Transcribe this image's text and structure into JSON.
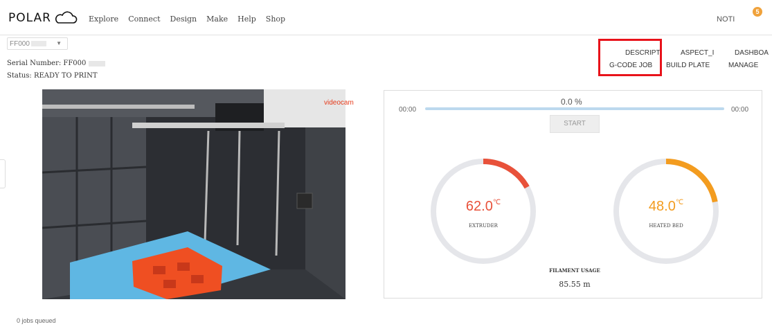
{
  "header": {
    "logo_text": "POLAR",
    "nav": [
      "Explore",
      "Connect",
      "Design",
      "Make",
      "Help",
      "Shop"
    ],
    "notifications_label": "NOTI",
    "notifications_count": "5"
  },
  "printer": {
    "selected": "FF000",
    "serial_label": "Serial Number: FF000",
    "status_label": "Status: READY TO PRINT"
  },
  "tabs": {
    "row1": [
      "DESCRIPT",
      "ASPECT_I",
      "DASHBOA"
    ],
    "row2": [
      "G-CODE JOB",
      "BUILD PLATE",
      "MANAGE"
    ]
  },
  "webcam": {
    "label": "videocam"
  },
  "print": {
    "progress_text": "0.0 %",
    "progress": 0.0,
    "elapsed": "00:00",
    "remaining": "00:00",
    "start_label": "START"
  },
  "gauges": {
    "extruder": {
      "value": "62.0",
      "unit": "℃",
      "label": "EXTRUDER",
      "color": "#e8513a",
      "fill": 0.17
    },
    "bed": {
      "value": "48.0",
      "unit": "℃",
      "label": "HEATED BED",
      "color": "#f39c1f",
      "fill": 0.22
    }
  },
  "filament": {
    "label": "FILAMENT USAGE",
    "value": "85.55 m"
  },
  "footer": {
    "jobs_queued": "0 jobs queued"
  }
}
